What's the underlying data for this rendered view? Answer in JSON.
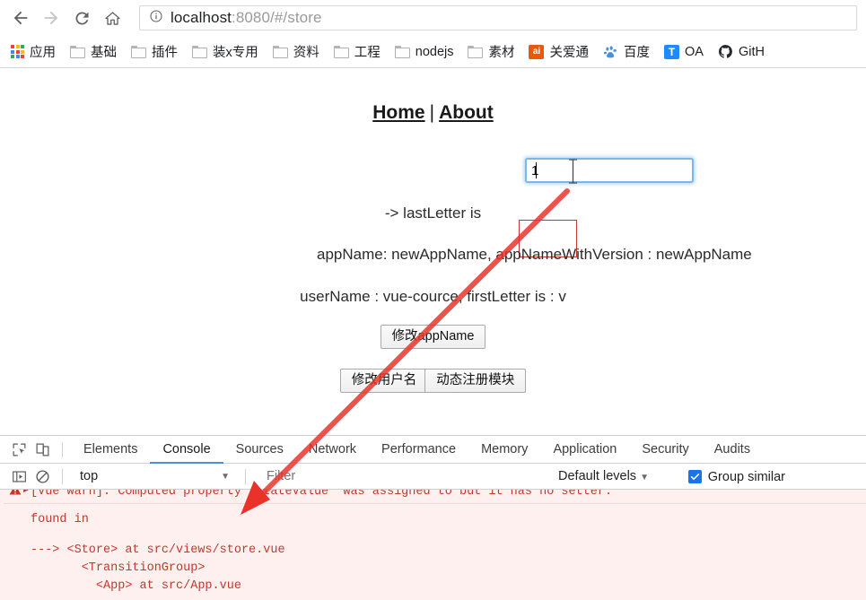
{
  "browser": {
    "nav": {
      "back_label": "Back",
      "forward_label": "Forward",
      "reload_label": "Reload",
      "home_label": "Home"
    },
    "omnibox": {
      "info_icon": "info-circle-icon",
      "host": "localhost",
      "path": ":8080/#/store",
      "full_url": "localhost:8080/#/store"
    },
    "bookmarks": [
      {
        "label": "应用",
        "icon": "apps-grid-icon"
      },
      {
        "label": "基础",
        "icon": "folder-icon"
      },
      {
        "label": "插件",
        "icon": "folder-icon"
      },
      {
        "label": "装x专用",
        "icon": "folder-icon"
      },
      {
        "label": "资料",
        "icon": "folder-icon"
      },
      {
        "label": "工程",
        "icon": "folder-icon"
      },
      {
        "label": "nodejs",
        "icon": "folder-icon"
      },
      {
        "label": "素材",
        "icon": "folder-icon"
      },
      {
        "label": "关爱通",
        "icon": "ai-square-icon"
      },
      {
        "label": "百度",
        "icon": "baidu-paw-icon"
      },
      {
        "label": "OA",
        "icon": "t-square-icon"
      },
      {
        "label": "GitH",
        "icon": "github-icon"
      }
    ]
  },
  "page": {
    "nav": {
      "home": "Home",
      "separator": "|",
      "about": "About"
    },
    "input": {
      "value": "1",
      "placeholder": ""
    },
    "lines": {
      "last_letter": "-> lastLetter is",
      "app_name": "appName: newAppName, appNameWithVersion : newAppName",
      "user_name": "userName : vue-cource, firstLetter is : v"
    },
    "buttons": {
      "change_app_name": "修改appName",
      "change_user_name": "修改用户名",
      "register_module": "动态注册模块"
    }
  },
  "devtools": {
    "toolbar_icons": [
      "inspect-element-icon",
      "device-toolbar-icon"
    ],
    "tabs": [
      {
        "label": "Elements",
        "active": false
      },
      {
        "label": "Console",
        "active": true
      },
      {
        "label": "Sources",
        "active": false
      },
      {
        "label": "Network",
        "active": false
      },
      {
        "label": "Performance",
        "active": false
      },
      {
        "label": "Memory",
        "active": false
      },
      {
        "label": "Application",
        "active": false
      },
      {
        "label": "Security",
        "active": false
      },
      {
        "label": "Audits",
        "active": false
      }
    ],
    "console_toolbar": {
      "sidebar_icon": "console-sidebar-icon",
      "clear_icon": "clear-console-icon",
      "context": "top",
      "context_caret": "chevron-down-icon",
      "filter_placeholder": "Filter",
      "levels": "Default levels",
      "levels_caret": "chevron-down-icon",
      "group_similar": "Group similar",
      "group_similar_checked": true
    },
    "console_messages": [
      {
        "icon": "warning-icon",
        "expander": "expand-triangle-icon",
        "text": "[Vue warn]: Computed property \"stateValue\" was assigned to but it has no setter."
      },
      {
        "text": "found in"
      },
      {
        "text": "---> <Store> at src/views/store.vue\n       <TransitionGroup>\n         <App> at src/App.vue"
      }
    ]
  },
  "annotation": {
    "highlight_rect_color": "#c0392b",
    "arrow_color": "#e8322a",
    "arrow_label": "red-annotation-arrow"
  }
}
